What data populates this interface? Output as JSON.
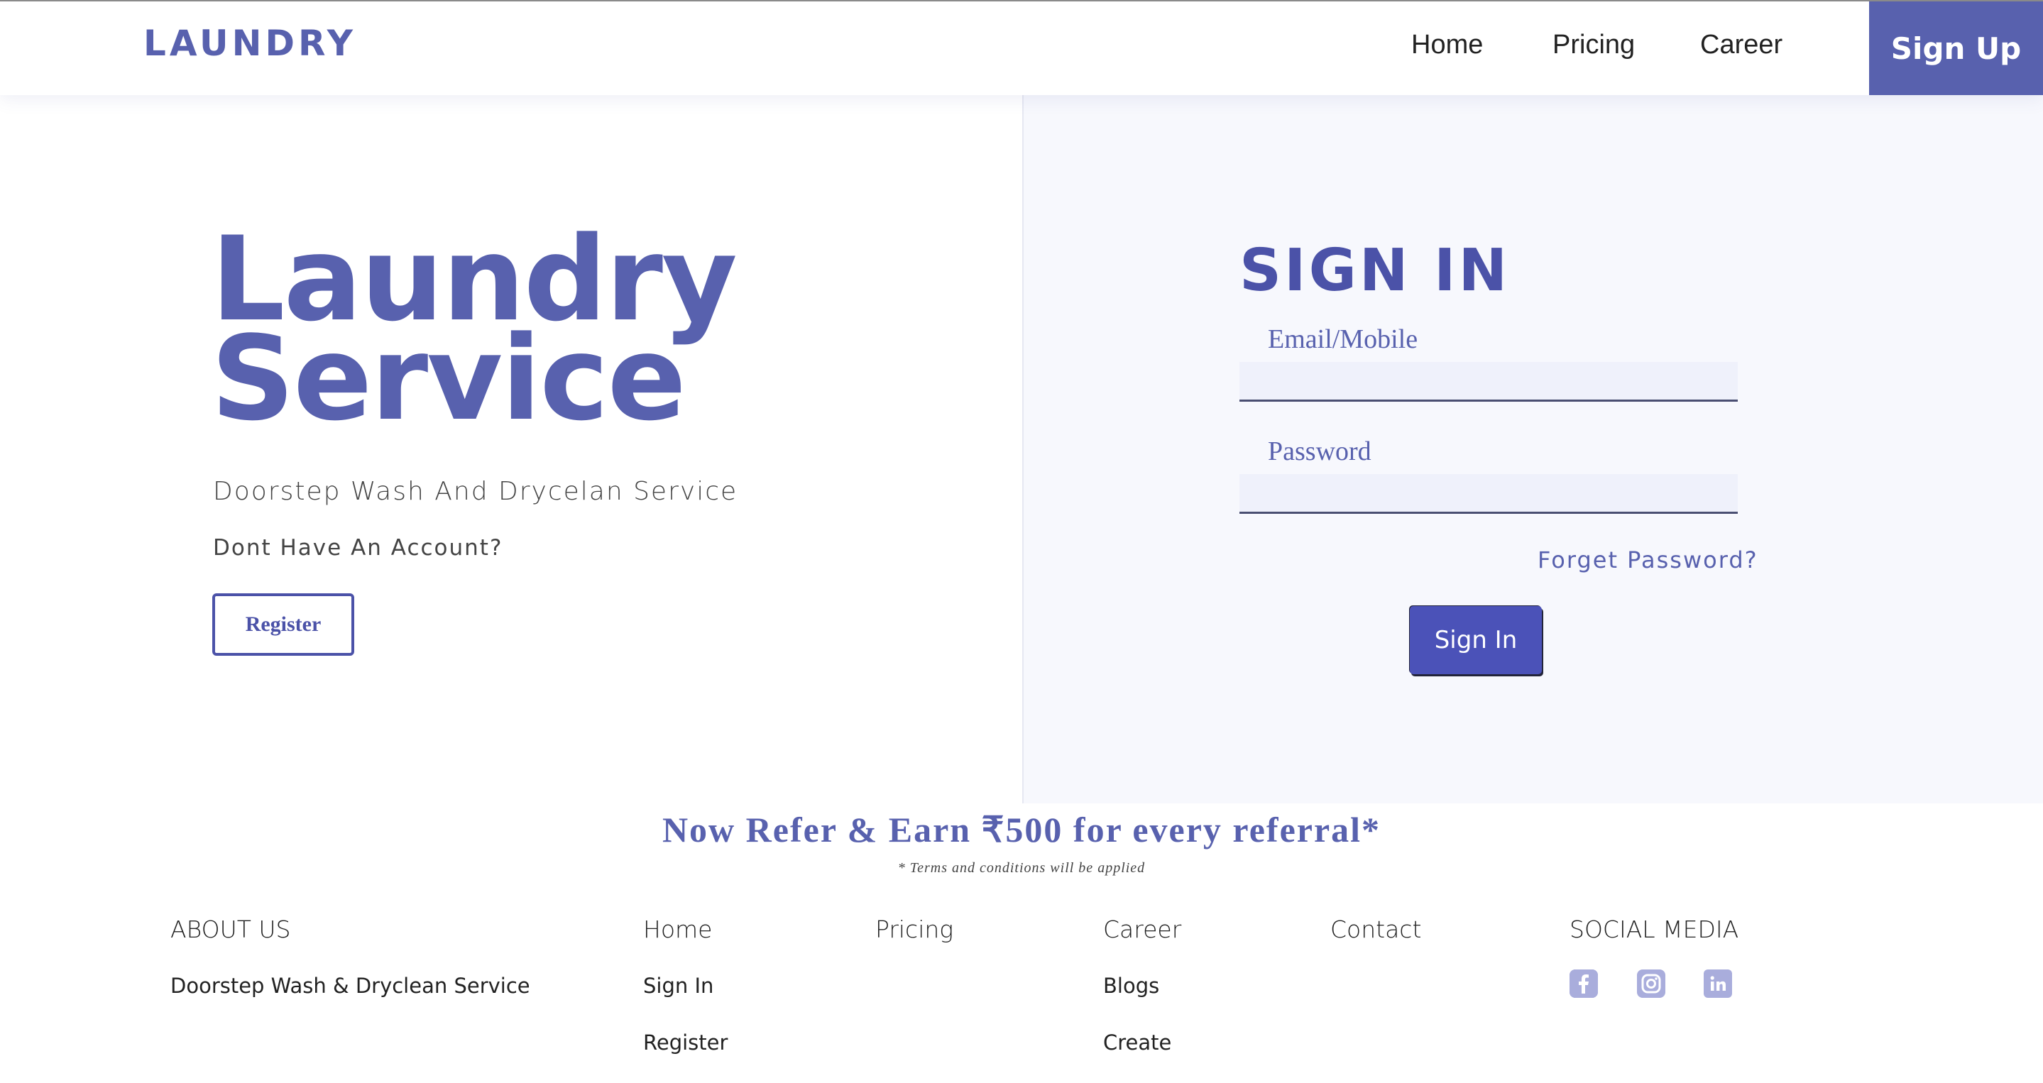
{
  "navbar": {
    "brand": "LAUNDRY",
    "links": [
      "Home",
      "Pricing",
      "Career"
    ],
    "signup_label": "Sign Up"
  },
  "hero": {
    "title_line1": "Laundry",
    "title_line2": "Service",
    "subtitle": "Doorstep Wash And Drycelan Service",
    "no_account": "Dont Have An Account?",
    "register_label": "Register"
  },
  "signin": {
    "title": "SIGN IN",
    "email_label": "Email/Mobile",
    "email_value": "",
    "password_label": "Password",
    "password_value": "",
    "forget_label": "Forget Password?",
    "button_label": "Sign In"
  },
  "referral": {
    "text": "Now Refer & Earn ₹500 for every referral*",
    "terms": "* Terms and conditions will be applied"
  },
  "footer": {
    "about": {
      "heading": "ABOUT US",
      "text": "Doorstep Wash & Dryclean Service"
    },
    "home": {
      "heading": "Home",
      "links": [
        "Sign In",
        "Register"
      ]
    },
    "pricing": {
      "heading": "Pricing"
    },
    "career": {
      "heading": "Career",
      "links": [
        "Blogs",
        "Create"
      ]
    },
    "contact": {
      "heading": "Contact"
    },
    "social": {
      "heading": "SOCIAL MEDIA",
      "icons": [
        "facebook-icon",
        "instagram-icon",
        "linkedin-icon"
      ]
    }
  },
  "colors": {
    "brand": "#5861ae",
    "button": "#4b52b8",
    "panel_bg": "#f7f8fd",
    "icon": "#a9addc"
  }
}
